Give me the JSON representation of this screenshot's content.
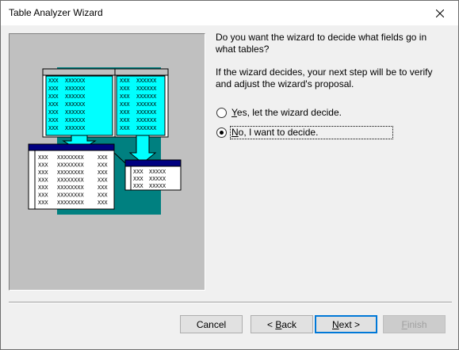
{
  "window": {
    "title": "Table Analyzer Wizard"
  },
  "content": {
    "question": "Do you want the wizard to decide what fields go in what tables?",
    "explanation": "If the wizard decides, your next step will be to verify and adjust the wizard's proposal.",
    "options": [
      {
        "mnemonic": "Y",
        "rest": "es, let the wizard decide.",
        "selected": false
      },
      {
        "mnemonic": "N",
        "rest": "o, I want to decide.",
        "selected": true
      }
    ]
  },
  "illustration": {
    "cell_short": "XXX",
    "cell_long": "XXXXXXXX",
    "colors": {
      "teal": "#008080",
      "cyan": "#00ffff",
      "navy": "#000080",
      "gray": "#c0c0c0"
    }
  },
  "buttons": {
    "cancel": "Cancel",
    "back_mnemonic": "B",
    "back_prefix": "< ",
    "back_rest": "ack",
    "next_mnemonic": "N",
    "next_rest": "ext >",
    "finish_mnemonic": "F",
    "finish_rest": "inish"
  }
}
